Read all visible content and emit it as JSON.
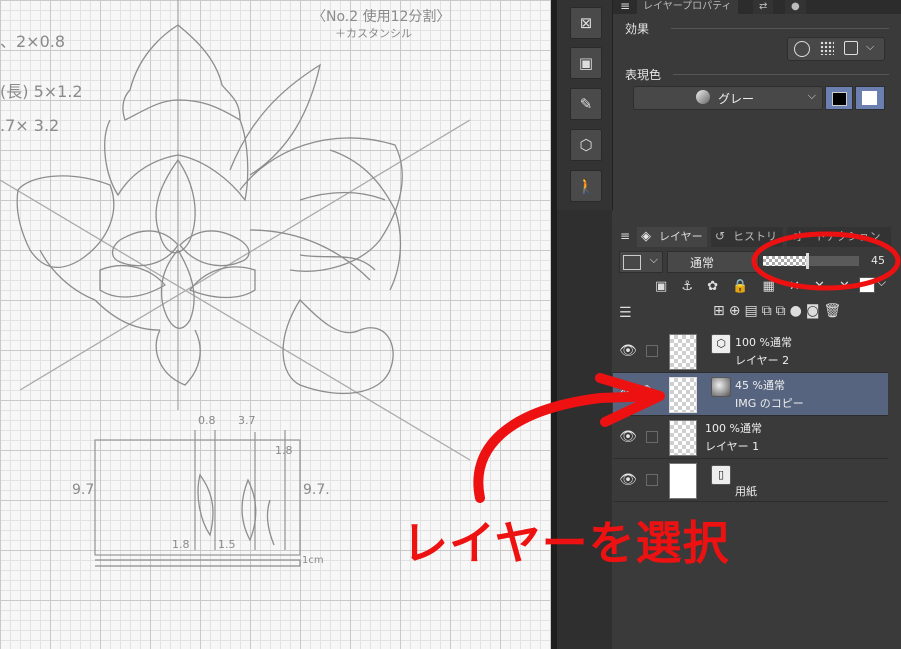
{
  "canvas": {
    "note_title": "〈No.2 使用12分割〉",
    "note_sub": "＋カスタンシル",
    "dim1": "、2×0.8",
    "dim2": "(長) 5×1.2",
    "dim3": ".7× 3.2",
    "vase_left": "9.7",
    "vase_right": "9.7.",
    "vase_top1": "0.8",
    "vase_top2": "3.7",
    "vase_bottom1": "1.8",
    "vase_bottom2": "1.5",
    "vase_bottom3": "1cm",
    "vase_side": "1.8"
  },
  "toolbar": {
    "icons": [
      "grid-transform-icon",
      "folder-image-icon",
      "edit-page-icon",
      "folder-3d-icon",
      "figure-pose-icon"
    ],
    "glyphs": [
      "⊠",
      "▣",
      "✎",
      "⬡",
      "🚶"
    ]
  },
  "properties": {
    "tab_label": "レイヤープロパティ",
    "effect_label": "効果",
    "expression_label": "表現色",
    "color_mode": "グレー"
  },
  "layers_panel": {
    "tab_layers": "レイヤー",
    "tab_history": "ヒストリ",
    "tab_other": "オートアクション",
    "blend_mode": "通常",
    "opacity": "45",
    "opacity_fraction": 0.45,
    "rows": [
      {
        "mode": "100 %通常",
        "name": "レイヤー 2",
        "thumb": "checker",
        "icon": "3d-cube-icon",
        "selected": false
      },
      {
        "mode": "45 %通常",
        "name": "IMG のコピー",
        "thumb": "checker",
        "icon": "gray-layer-icon",
        "selected": true
      },
      {
        "mode": "100 %通常",
        "name": "レイヤー 1",
        "thumb": "checker",
        "icon": "",
        "selected": false
      },
      {
        "mode": "",
        "name": "用紙",
        "thumb": "white",
        "icon": "paper-icon",
        "selected": false
      }
    ]
  },
  "annotation": {
    "text": "レイヤーを選択",
    "color": "#ee1111"
  }
}
